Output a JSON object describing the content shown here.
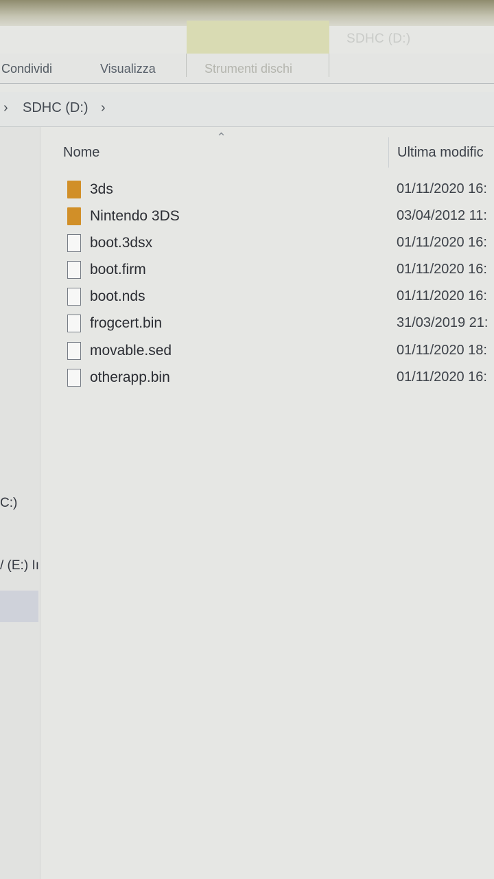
{
  "window": {
    "title": "SDHC (D:)"
  },
  "ribbon": {
    "tabs": [
      "Condividi",
      "Visualizza",
      "Strumenti dischi"
    ]
  },
  "address": {
    "location": "SDHC (D:)"
  },
  "navpane": {
    "items": [
      "C:)",
      "/ (E:) Iı"
    ]
  },
  "columns": {
    "name": "Nome",
    "modified": "Ultima modific"
  },
  "files": [
    {
      "name": "3ds",
      "date": "01/11/2020 16:",
      "type": "folder"
    },
    {
      "name": "Nintendo 3DS",
      "date": "03/04/2012 11:",
      "type": "folder"
    },
    {
      "name": "boot.3dsx",
      "date": "01/11/2020 16:",
      "type": "file"
    },
    {
      "name": "boot.firm",
      "date": "01/11/2020 16:",
      "type": "file"
    },
    {
      "name": "boot.nds",
      "date": "01/11/2020 16:",
      "type": "file"
    },
    {
      "name": "frogcert.bin",
      "date": "31/03/2019 21:",
      "type": "file"
    },
    {
      "name": "movable.sed",
      "date": "01/11/2020 18:",
      "type": "file"
    },
    {
      "name": "otherapp.bin",
      "date": "01/11/2020 16:",
      "type": "file"
    }
  ],
  "colors": {
    "folder": "#d18f28",
    "tools_tab_highlight": "#d9dbb3"
  }
}
